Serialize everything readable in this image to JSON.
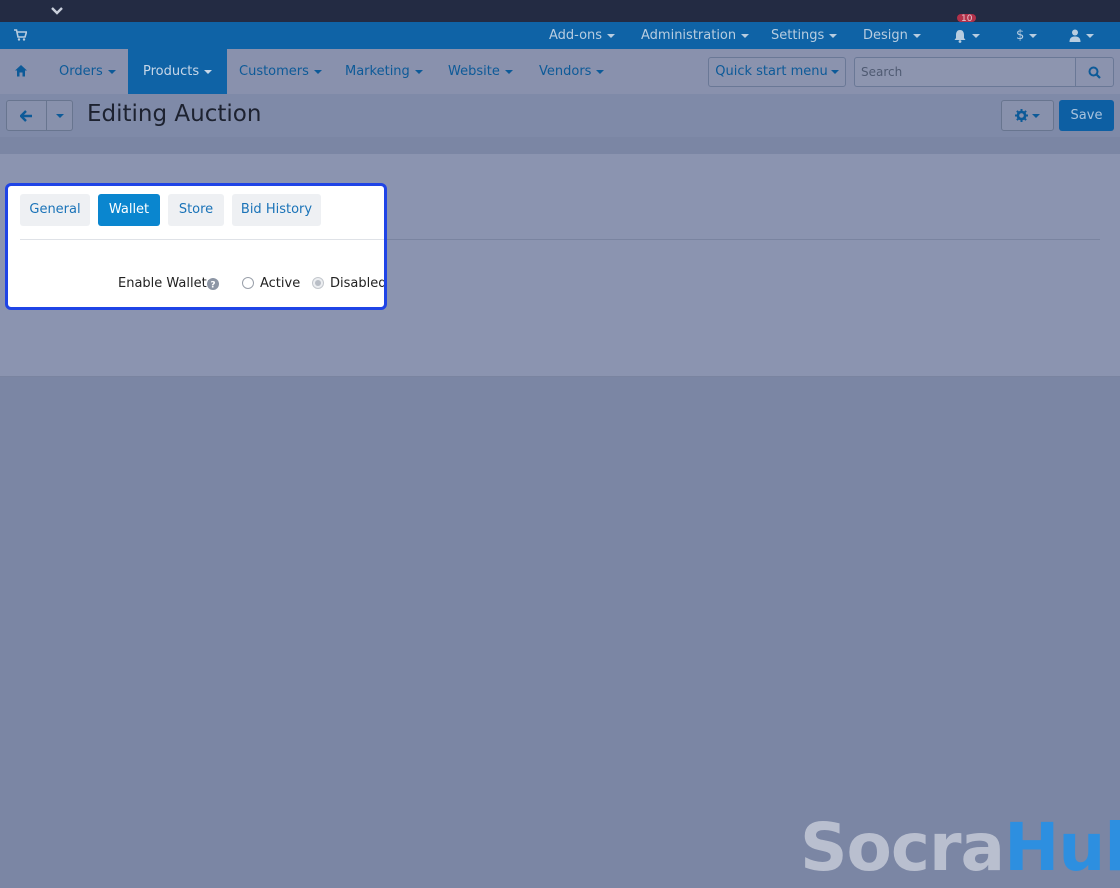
{
  "admin_bar": {
    "items": [
      {
        "label": "Add-ons"
      },
      {
        "label": "Administration"
      },
      {
        "label": "Settings"
      },
      {
        "label": "Design"
      }
    ],
    "notification_count": "10",
    "currency": "$"
  },
  "nav": {
    "items": [
      {
        "label": "Orders"
      },
      {
        "label": "Products"
      },
      {
        "label": "Customers"
      },
      {
        "label": "Marketing"
      },
      {
        "label": "Website"
      },
      {
        "label": "Vendors"
      }
    ],
    "active": "Products",
    "quick_start_label": "Quick start menu",
    "search_placeholder": "Search"
  },
  "title_bar": {
    "title": "Editing Auction",
    "save_label": "Save"
  },
  "tabs": [
    {
      "label": "General"
    },
    {
      "label": "Wallet"
    },
    {
      "label": "Store"
    },
    {
      "label": "Bid History"
    }
  ],
  "active_tab": "Wallet",
  "wallet": {
    "field_label": "Enable Wallet:",
    "options": [
      {
        "label": "Active",
        "checked": false
      },
      {
        "label": "Disabled",
        "checked": true
      }
    ]
  },
  "logo": {
    "part1": "Socra",
    "part2": "Hub",
    "colors": {
      "part1": "#b9bfcf",
      "part2": "#2d8fe0"
    }
  },
  "colors": {
    "accent": "#0a86cf",
    "highlight_border": "#1f44e6",
    "primary_button": "#0d5fa3"
  }
}
